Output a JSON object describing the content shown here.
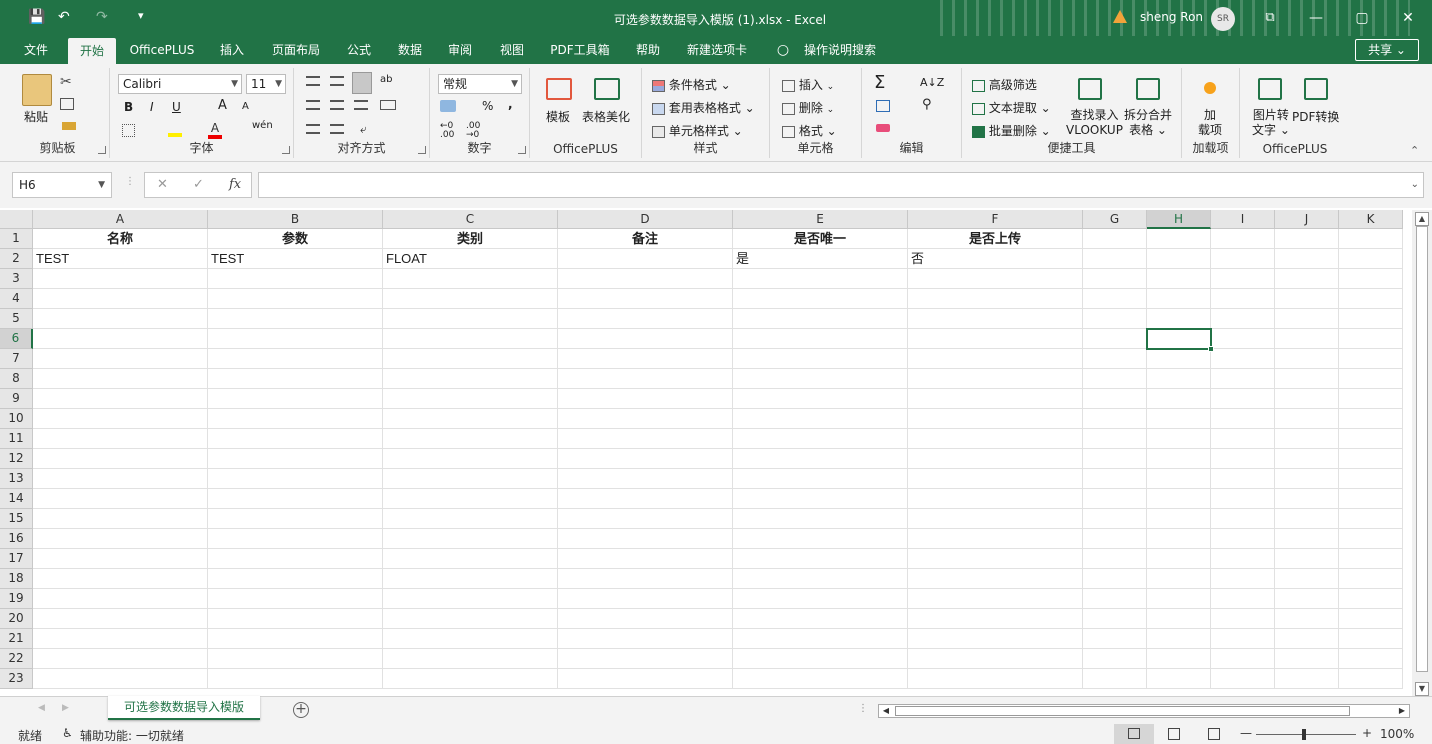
{
  "window": {
    "title": "可选参数数据导入模版 (1).xlsx  -  Excel",
    "user": "sheng Ron",
    "avatar": "SR",
    "minimize": "—",
    "restore": "▢",
    "close": "✕",
    "ribbon_display": "⧉"
  },
  "quick_access": {
    "save": "💾",
    "undo": "↶",
    "redo": "↷",
    "more": "▾"
  },
  "menu": {
    "tabs": [
      "文件",
      "开始",
      "OfficePLUS",
      "插入",
      "页面布局",
      "公式",
      "数据",
      "审阅",
      "视图",
      "PDF工具箱",
      "帮助",
      "新建选项卡"
    ],
    "active_index": 1,
    "tell_me": "操作说明搜索",
    "share": "共享 ⌄"
  },
  "ribbon": {
    "clipboard": {
      "label": "剪贴板",
      "paste": "粘贴"
    },
    "font": {
      "label": "字体",
      "name": "Calibri",
      "size": "11",
      "bold": "B",
      "italic": "I",
      "underline": "U",
      "grow": "A",
      "shrink": "A",
      "phonetic": "wén"
    },
    "alignment": {
      "label": "对齐方式"
    },
    "number": {
      "label": "数字",
      "format": "常规",
      "percent": "%",
      "comma": ","
    },
    "officeplus1": {
      "label": "OfficePLUS",
      "template": "模板",
      "beautify": "表格美化"
    },
    "styles": {
      "label": "样式",
      "conditional": "条件格式 ⌄",
      "table_format": "套用表格格式 ⌄",
      "cell_style": "单元格样式 ⌄"
    },
    "cells": {
      "label": "单元格",
      "insert": "插入",
      "delete": "删除",
      "format": "格式 ⌄"
    },
    "editing": {
      "label": "编辑",
      "sum": "Σ"
    },
    "tools": {
      "label": "便捷工具",
      "advanced_filter": "高级筛选",
      "text_extract": "文本提取 ⌄",
      "batch_delete": "批量删除 ⌄",
      "vlookup_1": "查找录入",
      "vlookup_2": "VLOOKUP",
      "split_1": "拆分合并",
      "split_2": "表格 ⌄"
    },
    "addins": {
      "label": "加载项",
      "btn_1": "加",
      "btn_2": "载项"
    },
    "officeplus2": {
      "label": "OfficePLUS",
      "img_1": "图片转",
      "img_2": "文字 ⌄",
      "pdf": "PDF转换"
    }
  },
  "formula_bar": {
    "name_box": "H6",
    "fx": "fx",
    "cancel": "✕",
    "enter": "✓",
    "value": ""
  },
  "sheet": {
    "columns": [
      "A",
      "B",
      "C",
      "D",
      "E",
      "F",
      "G",
      "H",
      "I",
      "J",
      "K"
    ],
    "selected_col": "H",
    "selected_row": 6,
    "rows": [
      "1",
      "2",
      "3",
      "4",
      "5",
      "6",
      "7",
      "8",
      "9",
      "10",
      "11",
      "12",
      "13",
      "14",
      "15",
      "16",
      "17",
      "18",
      "19",
      "20",
      "21",
      "22",
      "23"
    ],
    "cells": {
      "A1": "名称",
      "B1": "参数",
      "C1": "类别",
      "D1": "备注",
      "E1": "是否唯一",
      "F1": "是否上传",
      "A2": "TEST",
      "B2": "TEST",
      "C2": "FLOAT",
      "D2": "",
      "E2": "是",
      "F2": "否"
    },
    "tab_name": "可选参数数据导入模版",
    "add_sheet": "+"
  },
  "status": {
    "ready": "就绪",
    "accessibility": "辅助功能: 一切就绪",
    "zoom": "100%",
    "zoom_out": "—",
    "zoom_in": "+"
  }
}
